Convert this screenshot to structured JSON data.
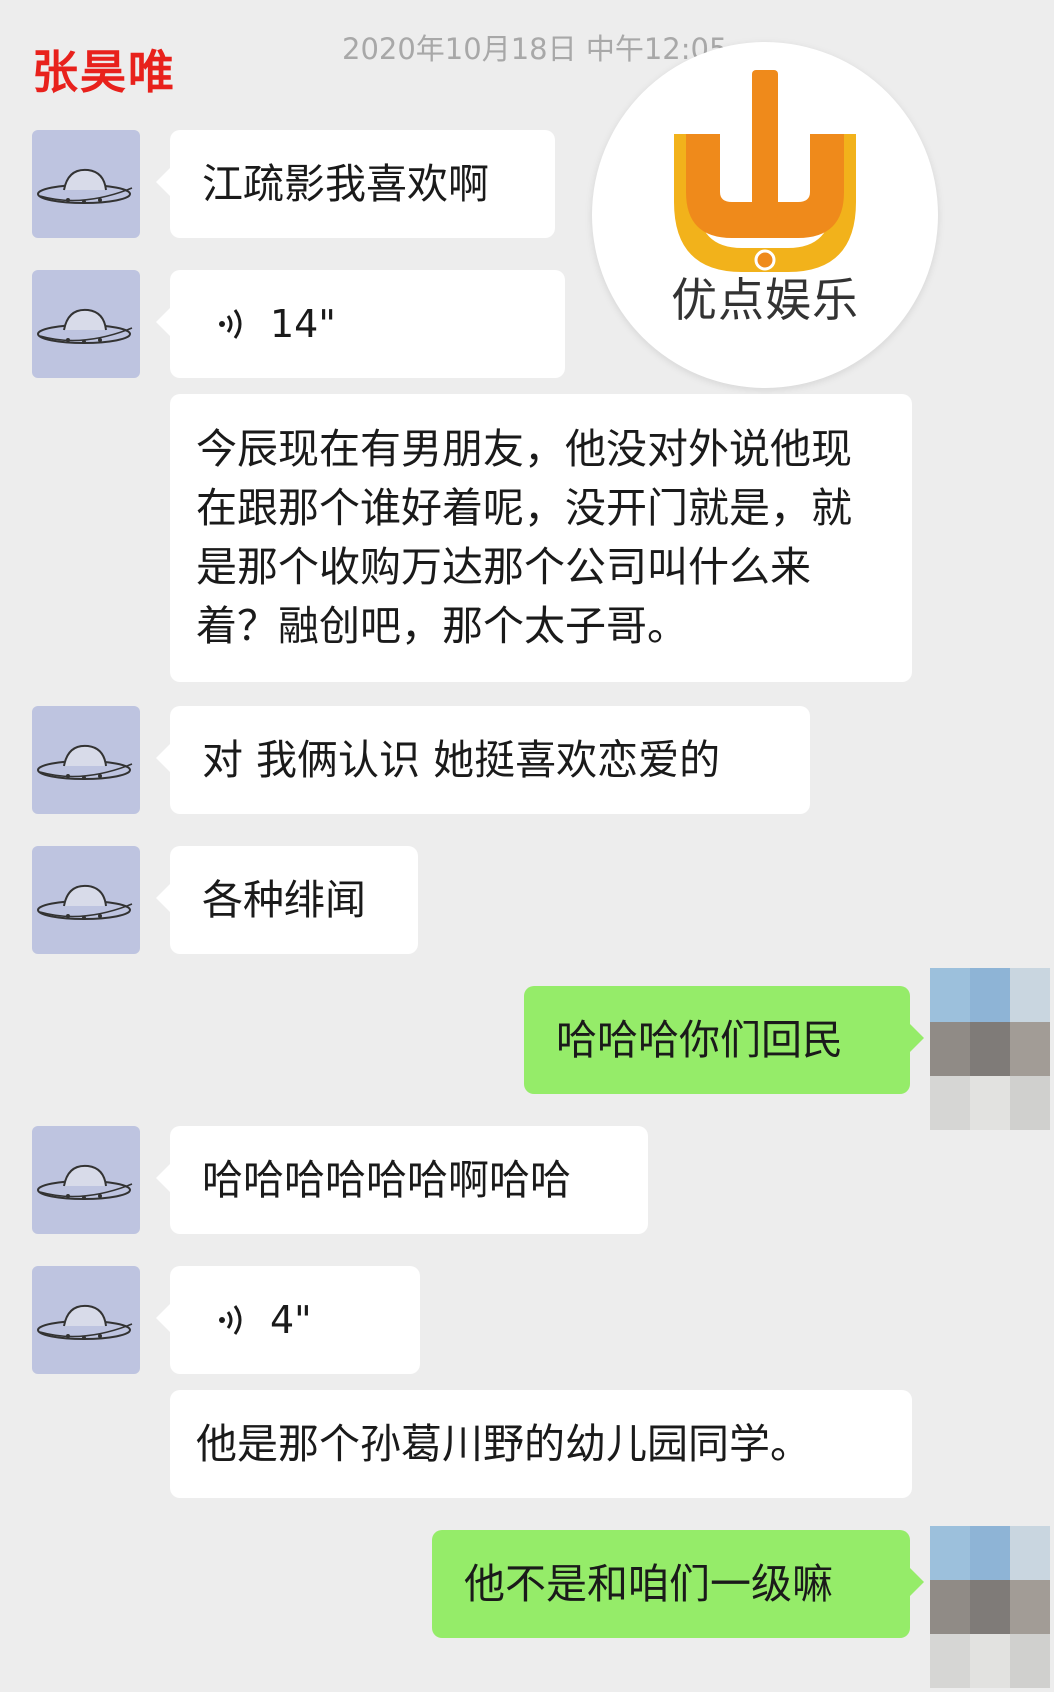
{
  "header": {
    "name": "张昊唯",
    "timestamp": "2020年10月18日 中午12:05"
  },
  "watermark": {
    "logo_text": "优点娱乐"
  },
  "messages": [
    {
      "type": "text",
      "text": "江疏影我喜欢啊"
    },
    {
      "type": "voice",
      "duration": "14\""
    },
    {
      "type": "text",
      "text": "今辰现在有男朋友，他没对外说他现在跟那个谁好着呢，没开门就是，就是那个收购万达那个公司叫什么来着？融创吧，那个太子哥。"
    },
    {
      "type": "text",
      "text": "对 我俩认识 她挺喜欢恋爱的"
    },
    {
      "type": "text",
      "text": "各种绯闻"
    },
    {
      "type": "text",
      "text": "哈哈哈你们回民",
      "self": true
    },
    {
      "type": "text",
      "text": "哈哈哈哈哈哈啊哈哈"
    },
    {
      "type": "voice",
      "duration": "4\""
    },
    {
      "type": "text",
      "text": "他是那个孙葛川野的幼儿园同学。"
    },
    {
      "type": "text",
      "text": "他不是和咱们一级嘛",
      "self": true
    }
  ],
  "colors": {
    "background": "#ededed",
    "bubble_incoming": "#ffffff",
    "bubble_outgoing": "#95ec69",
    "header_name": "#e8211c",
    "logo_orange": "#ef8a1b"
  }
}
